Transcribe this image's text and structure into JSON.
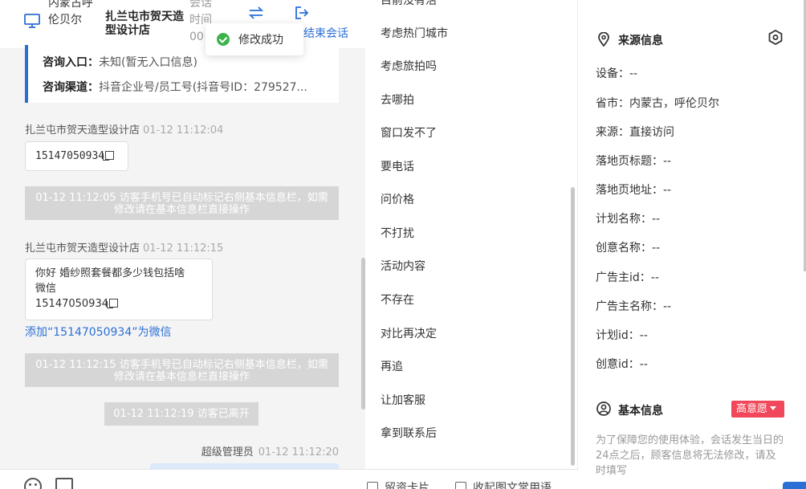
{
  "header": {
    "location": "内蒙古呼伦贝尔",
    "shop_name": "扎兰屯市贺天造型设计店",
    "duration_label": "会话时间00",
    "end_session": "结束会话"
  },
  "toast": {
    "text": "修改成功"
  },
  "source_card": {
    "entry_label": "咨询入口：",
    "entry_value": "未知(暂无入口信息)",
    "channel_label": "咨询渠道：",
    "channel_value": "抖音企业号/员工号(抖音号ID：279527..."
  },
  "messages": [
    {
      "sender": "扎兰屯市贺天造型设计店",
      "time": "01-12 11:12:04",
      "text": "15147050934"
    },
    {
      "system": "01-12 11:12:05 访客手机号已自动标记右侧基本信息栏，如需修改请在基本信息栏直接操作"
    },
    {
      "sender": "扎兰屯市贺天造型设计店",
      "time": "01-12 11:12:15",
      "text_line1": "你好 婚纱照套餐都多少钱包括啥",
      "text_line2": "微信",
      "text_line3": "15147050934"
    },
    {
      "link": "添加“15147050934”为微信"
    },
    {
      "system": "01-12 11:12:15 访客手机号已自动标记右侧基本信息栏，如需修改请在基本信息栏直接操作"
    },
    {
      "system": "01-12 11:12:19 访客已离开"
    },
    {
      "sender": "超级管理员",
      "time": "01-12 11:12:20"
    }
  ],
  "quick_replies": [
    "目前没有活",
    "考虑热门城市",
    "考虑旅拍吗",
    "去哪拍",
    "窗口发不了",
    "要电话",
    "问价格",
    "不打扰",
    "活动内容",
    "不存在",
    "对比再决定",
    "再追",
    "让加客服",
    "拿到联系后"
  ],
  "bottom_bar": {
    "card": "留资卡片",
    "favorites": "收起图文常用语"
  },
  "source_info": {
    "title": "来源信息",
    "fields": [
      "设备：--",
      "省市：内蒙古，呼伦贝尔",
      "来源：直接访问",
      "落地页标题：--",
      "落地页地址：--",
      "计划名称：--",
      "创意名称：--",
      "广告主id：--",
      "广告主名称：--",
      "计划id：--",
      "创意id：--"
    ]
  },
  "basic_info": {
    "title": "基本信息",
    "intent_badge": "高意愿",
    "note": "为了保障您的使用体验，会话发生当日的24点之后，顾客信息将无法修改，请及时填写"
  },
  "colors": {
    "accent": "#2b6fd6",
    "badge": "#f0485a",
    "success": "#3cb34a"
  },
  "icons": [
    "monitor-icon",
    "transfer-icon",
    "exit-icon",
    "check-icon",
    "copy-icon",
    "emoji-icon",
    "image-icon",
    "location-pin-icon",
    "settings-hex-icon",
    "user-icon",
    "caret-down-icon"
  ]
}
